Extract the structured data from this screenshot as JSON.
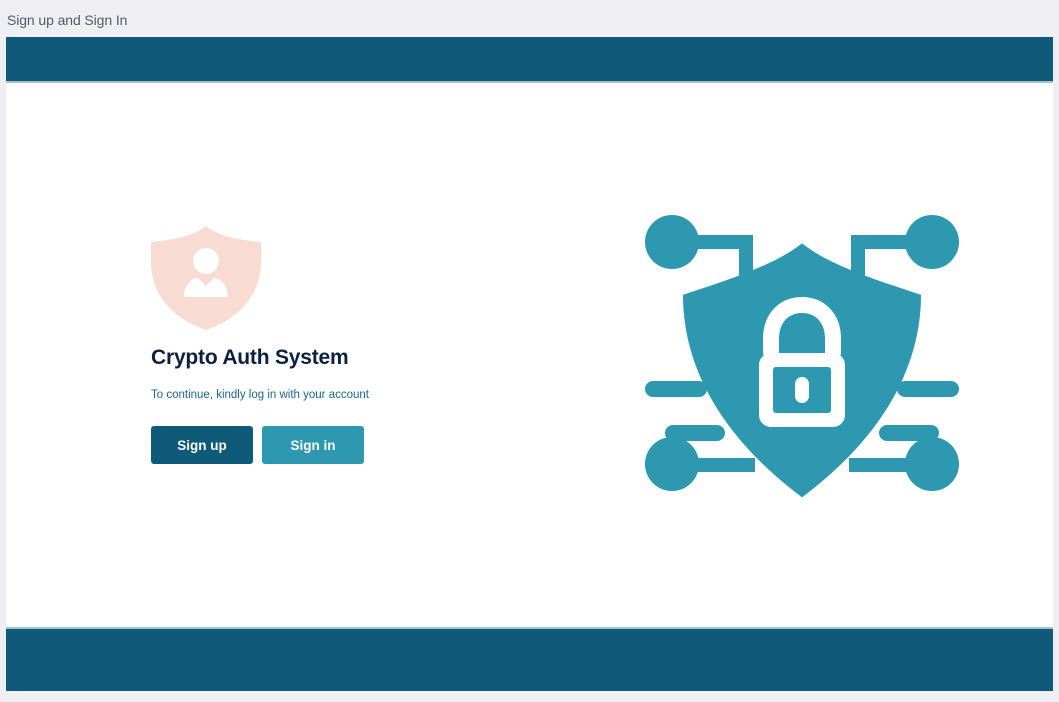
{
  "window": {
    "title": "Sign up and Sign In"
  },
  "hero": {
    "title": "Crypto Auth System",
    "subtitle": "To continue, kindly log in with your account",
    "signup_label": "Sign up",
    "signin_label": "Sign in"
  },
  "icons": {
    "hero_icon": "user-shield-icon",
    "illustration": "shield-lock-circuit-icon"
  },
  "colors": {
    "header_footer": "#0f5a78",
    "primary_button": "#0f5a78",
    "secondary_button": "#2e98b0",
    "illustration": "#2e98b0",
    "user_shield": "#f8dbd3",
    "title_text": "#0c1f3f"
  }
}
